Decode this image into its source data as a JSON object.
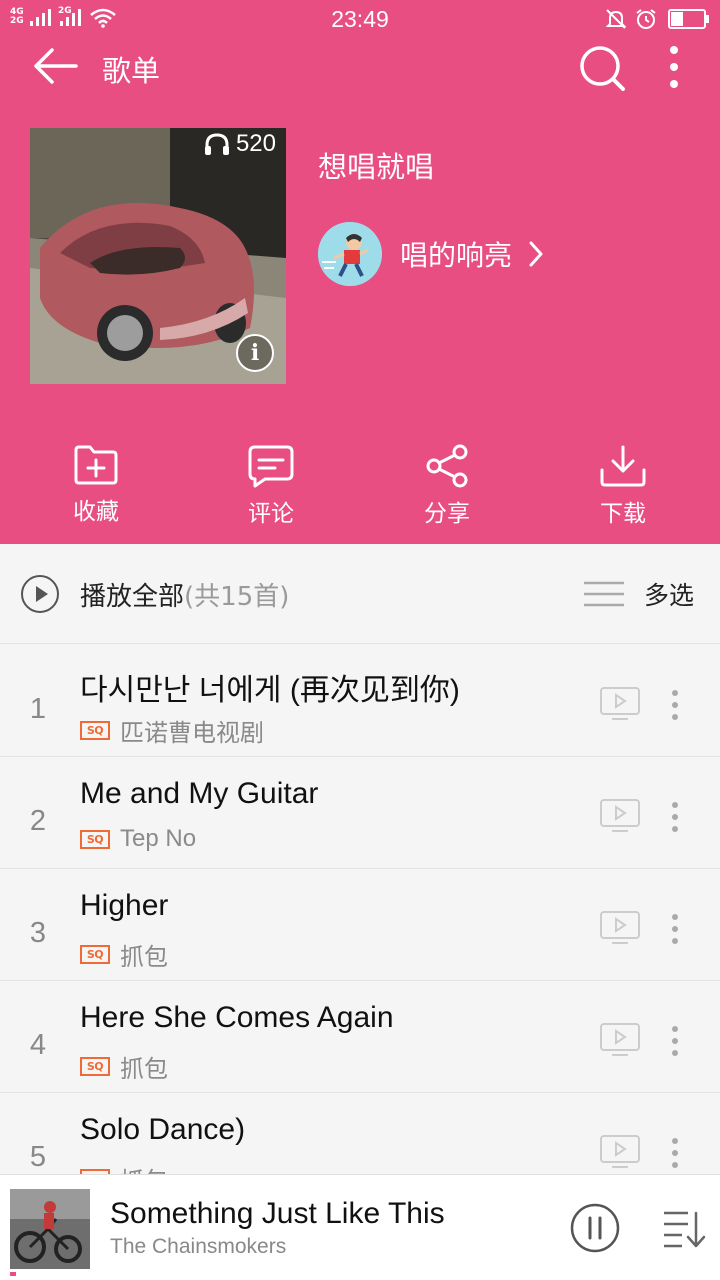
{
  "status_bar": {
    "network1": "4G",
    "network2": "2G",
    "network3": "2G",
    "time": "23:49"
  },
  "header": {
    "title": "歌单"
  },
  "playlist": {
    "play_count": "520",
    "name": "想唱就唱",
    "creator": "唱的响亮"
  },
  "actions": [
    {
      "label": "收藏",
      "icon": "folder-add-icon"
    },
    {
      "label": "评论",
      "icon": "comment-icon"
    },
    {
      "label": "分享",
      "icon": "share-icon"
    },
    {
      "label": "下载",
      "icon": "download-icon"
    }
  ],
  "play_all": {
    "label": "播放全部",
    "count": "(共15首)",
    "multi_select": "多选"
  },
  "songs": [
    {
      "num": "1",
      "title": "다시만난 너에게 (再次见到你)",
      "quality": "SQ",
      "artist": "匹诺曹电视剧"
    },
    {
      "num": "2",
      "title": "Me and My Guitar",
      "quality": "SQ",
      "artist": "Tep No"
    },
    {
      "num": "3",
      "title": "Higher",
      "quality": "SQ",
      "artist": "抓包"
    },
    {
      "num": "4",
      "title": "Here She Comes Again",
      "quality": "SQ",
      "artist": "抓包"
    },
    {
      "num": "5",
      "title": "Solo Dance)",
      "quality": "SQ",
      "artist": "抓包"
    }
  ],
  "now_playing": {
    "title": "Something Just Like This",
    "artist": "The Chainsmokers"
  },
  "colors": {
    "accent": "#e84e81",
    "quality_badge": "#f06a36"
  }
}
